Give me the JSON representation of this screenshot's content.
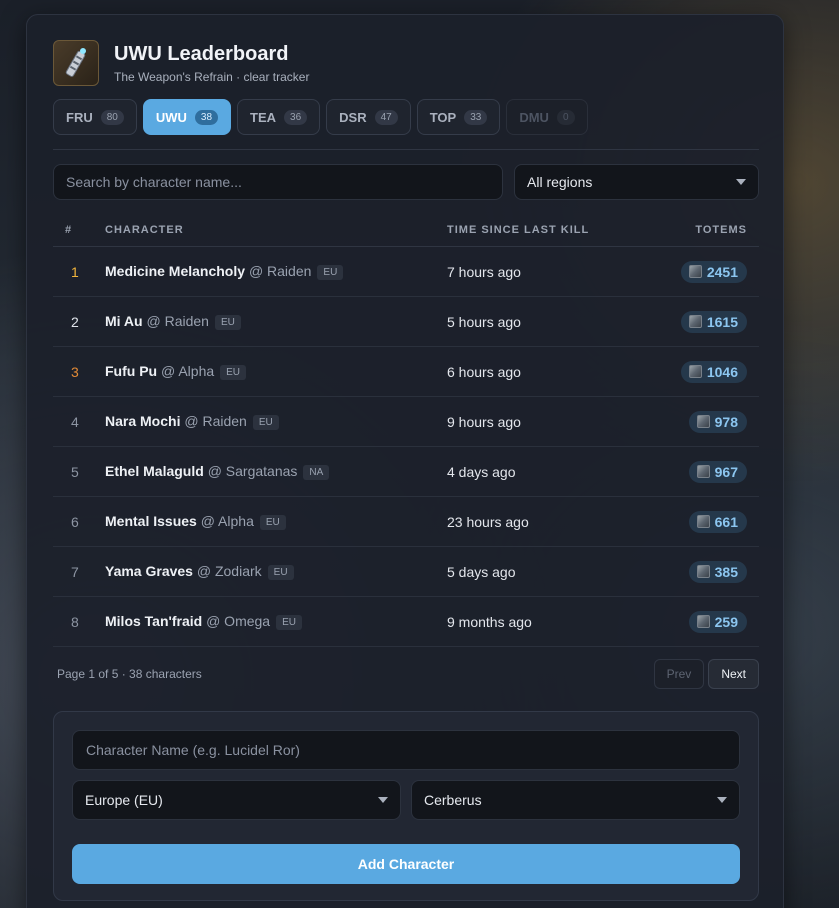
{
  "app": {
    "title": "UWU Leaderboard",
    "subtitle": "The Weapon's Refrain · clear tracker",
    "logo_icon": "ultimate-weapon-icon"
  },
  "tabs": [
    {
      "label": "FRU",
      "count": "80",
      "state": "normal"
    },
    {
      "label": "UWU",
      "count": "38",
      "state": "active"
    },
    {
      "label": "TEA",
      "count": "36",
      "state": "normal"
    },
    {
      "label": "DSR",
      "count": "47",
      "state": "normal"
    },
    {
      "label": "TOP",
      "count": "33",
      "state": "normal"
    },
    {
      "label": "DMU",
      "count": "0",
      "state": "disabled"
    }
  ],
  "filters": {
    "search_placeholder": "Search by character name...",
    "region_selected": "All regions"
  },
  "table": {
    "headers": {
      "rank": "#",
      "character": "CHARACTER",
      "time": "TIME SINCE LAST KILL",
      "totems": "TOTEMS"
    },
    "rows": [
      {
        "rank": "1",
        "name": "Medicine Melancholy",
        "world": "@ Raiden",
        "region": "EU",
        "time": "7 hours ago",
        "totems": "2451"
      },
      {
        "rank": "2",
        "name": "Mi Au",
        "world": "@ Raiden",
        "region": "EU",
        "time": "5 hours ago",
        "totems": "1615"
      },
      {
        "rank": "3",
        "name": "Fufu Pu",
        "world": "@ Alpha",
        "region": "EU",
        "time": "6 hours ago",
        "totems": "1046"
      },
      {
        "rank": "4",
        "name": "Nara Mochi",
        "world": "@ Raiden",
        "region": "EU",
        "time": "9 hours ago",
        "totems": "978"
      },
      {
        "rank": "5",
        "name": "Ethel Malaguld",
        "world": "@ Sargatanas",
        "region": "NA",
        "time": "4 days ago",
        "totems": "967"
      },
      {
        "rank": "6",
        "name": "Mental Issues",
        "world": "@ Alpha",
        "region": "EU",
        "time": "23 hours ago",
        "totems": "661"
      },
      {
        "rank": "7",
        "name": "Yama Graves",
        "world": "@ Zodiark",
        "region": "EU",
        "time": "5 days ago",
        "totems": "385"
      },
      {
        "rank": "8",
        "name": "Milos Tan'fraid",
        "world": "@ Omega",
        "region": "EU",
        "time": "9 months ago",
        "totems": "259"
      }
    ]
  },
  "pagination": {
    "info": "Page 1 of 5 · 38 characters",
    "prev_label": "Prev",
    "next_label": "Next"
  },
  "add_form": {
    "name_placeholder": "Character Name (e.g. Lucidel Ror)",
    "region_selected": "Europe (EU)",
    "world_selected": "Cerberus",
    "submit_label": "Add Character"
  },
  "colors": {
    "accent": "#5aa9e1",
    "rank_gold": "#f2b53c",
    "rank_bronze": "#e28a36",
    "totem_text": "#8cc6f0"
  }
}
